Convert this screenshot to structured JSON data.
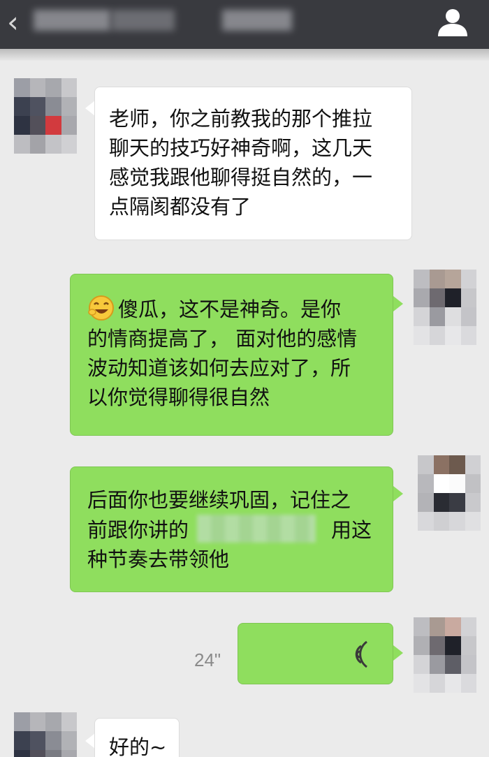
{
  "header": {
    "back_icon": "chevron-left-icon",
    "contact_name": "",
    "profile_icon": "person-icon"
  },
  "messages": [
    {
      "side": "left",
      "type": "text",
      "lines": [
        "老师，你之前教我的那个推拉",
        "聊天的技巧好神奇啊，这几天",
        "感觉我跟他聊得挺自然的，一",
        "点隔阂都没有了"
      ]
    },
    {
      "side": "right",
      "type": "text",
      "emoji": "grinning-face-emoji",
      "lines": [
        "傻瓜，这不是神奇。是你",
        "的情商提高了， 面对他的感情",
        "波动知道该如何去应对了，所",
        "以你觉得聊得很自然"
      ]
    },
    {
      "side": "right",
      "type": "text",
      "lines": [
        "后面你也要继续巩固，记住之",
        "前跟你讲的",
        "用这",
        "种节奏去带领他"
      ]
    },
    {
      "side": "right",
      "type": "voice",
      "duration": "24\"",
      "icon": "voice-wave-icon"
    },
    {
      "side": "left",
      "type": "text",
      "lines": [
        "好的~"
      ]
    }
  ],
  "colors": {
    "topbar": "#393a3f",
    "background": "#ebebeb",
    "bubble_green": "#8fde5e",
    "bubble_white": "#ffffff"
  }
}
